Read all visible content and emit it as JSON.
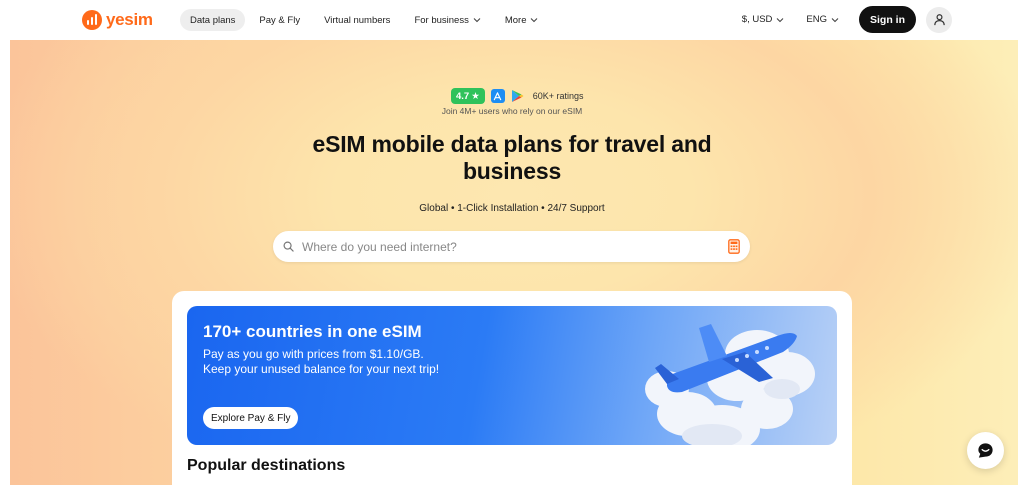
{
  "header": {
    "logo_text": "yesim",
    "nav": [
      {
        "label": "Data plans",
        "active": true,
        "dropdown": false
      },
      {
        "label": "Pay & Fly",
        "active": false,
        "dropdown": false
      },
      {
        "label": "Virtual numbers",
        "active": false,
        "dropdown": false
      },
      {
        "label": "For business",
        "active": false,
        "dropdown": true
      },
      {
        "label": "More",
        "active": false,
        "dropdown": true
      }
    ],
    "currency": "$, USD",
    "language": "ENG",
    "signin_label": "Sign in"
  },
  "hero": {
    "rating": "4.7",
    "rating_star": "★",
    "ratings_count": "60K+ ratings",
    "trust_text": "Join 4M+ users who rely on our eSIM",
    "title": "eSIM mobile data plans for travel and business",
    "features": "Global • 1-Click Installation • 24/7 Support",
    "search": {
      "placeholder": "Where do you need internet?",
      "value": ""
    }
  },
  "promo": {
    "title": "170+ countries in one eSIM",
    "line1": "Pay as you go with prices from $1.10/GB.",
    "line2": "Keep your unused balance for your next trip!",
    "button_label": "Explore Pay & Fly"
  },
  "popular": {
    "title": "Popular destinations"
  },
  "colors": {
    "brand": "#ff6a1a",
    "rating_green": "#2fc25b",
    "banner_blue": "#1a66f0",
    "signin_bg": "#111111"
  },
  "icons": [
    "logo-icon",
    "chevron-down-icon",
    "user-icon",
    "star-icon",
    "app-store-icon",
    "google-play-icon",
    "search-icon",
    "calculator-icon",
    "airplane-icon",
    "chat-icon"
  ]
}
